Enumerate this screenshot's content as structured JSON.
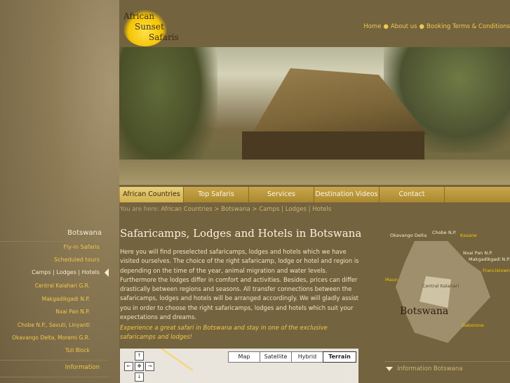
{
  "logo": {
    "line1": "African",
    "line2": "Sunset",
    "line3": "Safaris"
  },
  "topnav": {
    "home": "Home",
    "about": "About us",
    "terms": "Booking Terms & Conditions"
  },
  "mainnav": [
    {
      "label": "African Countries",
      "active": true
    },
    {
      "label": "Top Safaris"
    },
    {
      "label": "Services"
    },
    {
      "label": "Destination Videos"
    },
    {
      "label": "Contact"
    }
  ],
  "breadcrumb": {
    "prefix": "You are here:",
    "path": "African Countries  >  Botswana  >  Camps | Lodges | Hotels"
  },
  "sidebar": {
    "heading": "Botswana",
    "items": [
      {
        "label": "Fly-in Safaris"
      },
      {
        "label": "Scheduled tours"
      },
      {
        "label": "Camps | Lodges | Hotels",
        "current": true
      },
      {
        "label": "Central Kalahari G.R."
      },
      {
        "label": "Makgadikgadi N.P."
      },
      {
        "label": "Nxai Pan N.P."
      },
      {
        "label": "Chobe N.P., Savuti, Linyanti"
      },
      {
        "label": "Okavango Delta, Moremi G.R."
      },
      {
        "label": "Tuli Block"
      }
    ],
    "info": "Information"
  },
  "content": {
    "title": "Safaricamps, Lodges and Hotels in Botswana",
    "paragraph": "Here you will find preselected safaricamps, lodges and hotels which we have visited ourselves. The choice of the right safaricamp, lodge or hotel and region is depending on the time of the year, animal migration and water levels. Furthermore the lodges differ in comfort and activities. Besides, prices can differ drastically between regions and seasons. All transfer connections between the safaricamps, lodges and hotels will be arranged accordingly. We will gladly assist you in order to choose the right safaricamps, lodges and hotels which suit your expectations and dreams.",
    "tagline": "Experience a great safari in Botswana and stay in one of the exclusive safaricamps and lodges!"
  },
  "map": {
    "buttons": [
      "Map",
      "Satellite",
      "Hybrid",
      "Terrain"
    ],
    "selected": "Terrain",
    "controls": {
      "up": "↑",
      "left": "←",
      "center": "✥",
      "right": "→",
      "down": "↓"
    }
  },
  "botswana_map": {
    "country": "Botswana",
    "labels": {
      "okavango": "Okavango Delta",
      "chobe": "Chobe N.P.",
      "kasane": "Kasane",
      "nxai": "Nxai Pan N.P.",
      "makgadikgadi": "Makgadikgadi N.P.",
      "francistown": "Francistown",
      "maun": "Maun",
      "central": "Central Kalahari",
      "gaborone": "Gaborone"
    }
  },
  "info_box": {
    "label": "Information Botswana"
  }
}
